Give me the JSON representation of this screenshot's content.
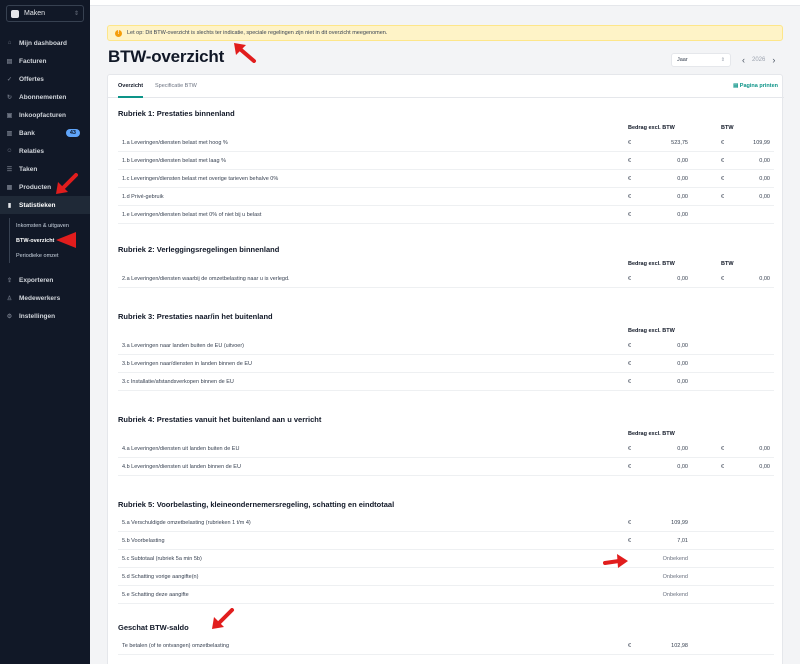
{
  "sidebar": {
    "brand": "Maken",
    "items": [
      {
        "label": "Mijn dashboard",
        "icon": "home-icon"
      },
      {
        "label": "Facturen",
        "icon": "document-icon"
      },
      {
        "label": "Offertes",
        "icon": "check-icon"
      },
      {
        "label": "Abonnementen",
        "icon": "repeat-icon"
      },
      {
        "label": "Inkoopfacturen",
        "icon": "inbox-icon"
      },
      {
        "label": "Bank",
        "icon": "bank-icon",
        "badge": "43"
      },
      {
        "label": "Relaties",
        "icon": "users-icon"
      },
      {
        "label": "Taken",
        "icon": "tasks-icon"
      },
      {
        "label": "Producten",
        "icon": "box-icon"
      },
      {
        "label": "Statistieken",
        "icon": "chart-icon"
      }
    ],
    "subitems": [
      "Inkomsten & uitgaven",
      "BTW-overzicht",
      "Periodieke omzet"
    ],
    "bottom_items": [
      {
        "label": "Exporteren",
        "icon": "export-icon"
      },
      {
        "label": "Medewerkers",
        "icon": "user-icon"
      },
      {
        "label": "Instellingen",
        "icon": "gear-icon"
      }
    ]
  },
  "alert": {
    "icon": "warning-icon",
    "text": "Let op: Dit BTW-overzicht is slechts ter indicatie, speciale regelingen zijn niet in dit overzicht meegenomen."
  },
  "page": {
    "title": "BTW-overzicht",
    "period_select": "Jaar",
    "year": "2026"
  },
  "tabs": [
    "Overzicht",
    "Specificatie BTW"
  ],
  "print_label": "Pagina printen",
  "col": {
    "amount": "Bedrag excl. BTW",
    "vat": "BTW"
  },
  "currency": "€",
  "sections": [
    {
      "title": "Rubriek 1: Prestaties binnenland",
      "rows": [
        {
          "label": "1.a Leveringen/diensten belast met hoog %",
          "amount": "523,75",
          "vat": "109,99"
        },
        {
          "label": "1.b Leveringen/diensten belast met laag %",
          "amount": "0,00",
          "vat": "0,00"
        },
        {
          "label": "1.c Leveringen/diensten belast met overige tarieven behalve 0%",
          "amount": "0,00",
          "vat": "0,00"
        },
        {
          "label": "1.d Privé-gebruik",
          "amount": "0,00",
          "vat": "0,00"
        },
        {
          "label": "1.e Leveringen/diensten belast met 0% of niet bij u belast",
          "amount": "0,00",
          "vat": ""
        }
      ]
    },
    {
      "title": "Rubriek 2: Verleggingsregelingen binnenland",
      "rows": [
        {
          "label": "2.a Leveringen/diensten waarbij de omzetbelasting naar u is verlegd.",
          "amount": "0,00",
          "vat": "0,00"
        }
      ]
    },
    {
      "title": "Rubriek 3: Prestaties naar/in het buitenland",
      "rows": [
        {
          "label": "3.a Leveringen naar landen buiten de EU (uitvoer)",
          "amount": "0,00",
          "vat": ""
        },
        {
          "label": "3.b Leveringen naar/diensten in landen binnen de EU",
          "amount": "0,00",
          "vat": ""
        },
        {
          "label": "3.c Installatie/afstandsverkopen binnen de EU",
          "amount": "0,00",
          "vat": ""
        }
      ]
    },
    {
      "title": "Rubriek 4: Prestaties vanuit het buitenland aan u verricht",
      "rows": [
        {
          "label": "4.a Leveringen/diensten uit landen buiten de EU",
          "amount": "0,00",
          "vat": "0,00"
        },
        {
          "label": "4.b Leveringen/diensten uit landen binnen de EU",
          "amount": "0,00",
          "vat": "0,00"
        }
      ]
    },
    {
      "title": "Rubriek 5: Voorbelasting, kleineondernemersregeling, schatting en eindtotaal",
      "rows": [
        {
          "label": "5.a Verschuldigde omzetbelasting (rubrieken 1 t/m 4)",
          "amount": "109,99"
        },
        {
          "label": "5.b Voorbelasting",
          "amount": "7,01"
        },
        {
          "label": "5.c Subtotaal (rubriek 5a min 5b)",
          "unknown": "Onbekend"
        },
        {
          "label": "5.d Schatting vorige aangifte(n)",
          "unknown": "Onbekend"
        },
        {
          "label": "5.e Schatting deze aangifte",
          "unknown": "Onbekend"
        }
      ]
    },
    {
      "title": "Geschat BTW-saldo",
      "rows": [
        {
          "label": "Te betalen (of te ontvangen) omzetbelasting",
          "amount": "102,98"
        }
      ]
    }
  ]
}
